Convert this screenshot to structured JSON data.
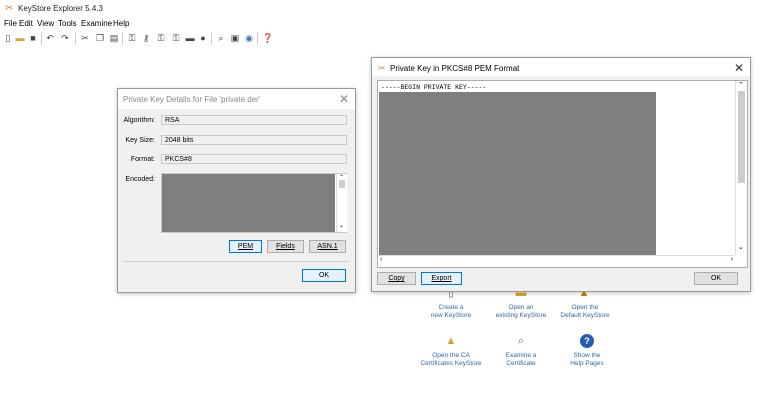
{
  "app": {
    "title": "KeyStore Explorer 5.4.3"
  },
  "menu": {
    "items": [
      "File",
      "Edit",
      "View",
      "Tools",
      "Examine",
      "Help"
    ]
  },
  "details_dialog": {
    "title": "Private Key Details for File 'private.der'",
    "algorithm_label": "Algorithm:",
    "algorithm_value": "RSA",
    "key_size_label": "Key Size:",
    "key_size_value": "2048 bits",
    "format_label": "Format:",
    "format_value": "PKCS#8",
    "encoded_label": "Encoded:",
    "pem_button": "PEM",
    "fields_button": "Fields",
    "asn1_button": "ASN.1",
    "ok_button": "OK"
  },
  "pem_dialog": {
    "title": "Private Key in PKCS#8 PEM Format",
    "header_line": "-----BEGIN PRIVATE KEY-----",
    "copy_button": "Copy",
    "export_button": "Export",
    "ok_button": "OK"
  },
  "quick_actions": [
    {
      "line1": "Create a",
      "line2": "new KeyStore",
      "icon": "new-keystore-icon"
    },
    {
      "line1": "Open an",
      "line2": "existing KeyStore",
      "icon": "open-folder-icon"
    },
    {
      "line1": "Open the",
      "line2": "Default KeyStore",
      "icon": "default-keystore-icon"
    },
    {
      "line1": "Open the CA",
      "line2": "Certificates KeyStore",
      "icon": "ca-certificates-icon"
    },
    {
      "line1": "Examine a",
      "line2": "Certificate",
      "icon": "magnifier-icon"
    },
    {
      "line1": "Show the",
      "line2": "Help Pages",
      "icon": "help-icon"
    }
  ]
}
